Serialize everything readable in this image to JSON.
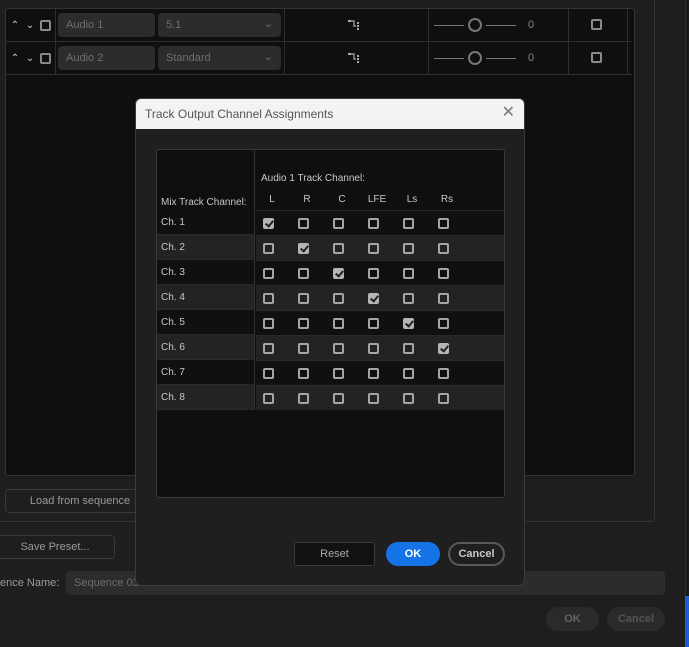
{
  "background": {
    "tracks": [
      {
        "name": "Audio 1",
        "type": "5.1",
        "pan_value": "0"
      },
      {
        "name": "Audio 2",
        "type": "Standard",
        "pan_value": "0"
      }
    ],
    "load_from_sequence_label": "Load from sequence",
    "save_preset_label": "Save Preset...",
    "sequence_name_label": "ence Name:",
    "sequence_name_value": "Sequence 03",
    "ok_label": "OK",
    "cancel_label": "Cancel"
  },
  "dialog": {
    "title": "Track Output Channel Assignments",
    "mix_track_channel_label": "Mix Track Channel:",
    "track_channel_label": "Audio 1 Track Channel:",
    "columns": [
      "L",
      "R",
      "C",
      "LFE",
      "Ls",
      "Rs"
    ],
    "rows": [
      {
        "label": "Ch. 1",
        "checked": [
          true,
          false,
          false,
          false,
          false,
          false
        ]
      },
      {
        "label": "Ch. 2",
        "checked": [
          false,
          true,
          false,
          false,
          false,
          false
        ]
      },
      {
        "label": "Ch. 3",
        "checked": [
          false,
          false,
          true,
          false,
          false,
          false
        ]
      },
      {
        "label": "Ch. 4",
        "checked": [
          false,
          false,
          false,
          true,
          false,
          false
        ]
      },
      {
        "label": "Ch. 5",
        "checked": [
          false,
          false,
          false,
          false,
          true,
          false
        ]
      },
      {
        "label": "Ch. 6",
        "checked": [
          false,
          false,
          false,
          false,
          false,
          true
        ]
      },
      {
        "label": "Ch. 7",
        "checked": [
          false,
          false,
          false,
          false,
          false,
          false
        ]
      },
      {
        "label": "Ch. 8",
        "checked": [
          false,
          false,
          false,
          false,
          false,
          false
        ]
      }
    ],
    "reset_label": "Reset",
    "ok_label": "OK",
    "cancel_label": "Cancel",
    "accent_color": "#1473e6"
  }
}
